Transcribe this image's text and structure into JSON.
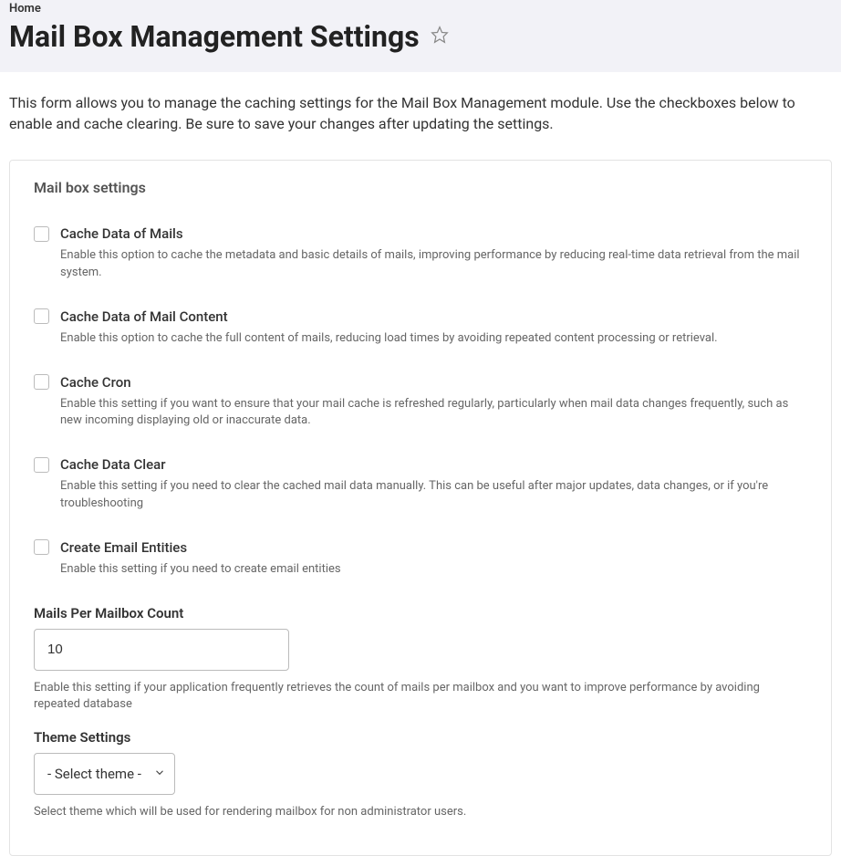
{
  "breadcrumb": {
    "home": "Home"
  },
  "page": {
    "title": "Mail Box Management Settings"
  },
  "intro": "This form allows you to manage the caching settings for the Mail Box Management module. Use the checkboxes below to enable and cache clearing. Be sure to save your changes after updating the settings.",
  "panel": {
    "title": "Mail box settings"
  },
  "checks": [
    {
      "label": "Cache Data of Mails",
      "desc": "Enable this option to cache the metadata and basic details of mails, improving performance by reducing real-time data retrieval from the mail system."
    },
    {
      "label": "Cache Data of Mail Content",
      "desc": "Enable this option to cache the full content of mails, reducing load times by avoiding repeated content processing or retrieval."
    },
    {
      "label": "Cache Cron",
      "desc": "Enable this setting if you want to ensure that your mail cache is refreshed regularly, particularly when mail data changes frequently, such as new incoming displaying old or inaccurate data."
    },
    {
      "label": "Cache Data Clear",
      "desc": "Enable this setting if you need to clear the cached mail data manually. This can be useful after major updates, data changes, or if you're troubleshooting"
    },
    {
      "label": "Create Email Entities",
      "desc": "Enable this setting if you need to create email entities"
    }
  ],
  "mailsPerMailbox": {
    "label": "Mails Per Mailbox Count",
    "value": "10",
    "desc": "Enable this setting if your application frequently retrieves the count of mails per mailbox and you want to improve performance by avoiding repeated database"
  },
  "theme": {
    "label": "Theme Settings",
    "placeholder": "- Select theme -",
    "desc": "Select theme which will be used for rendering mailbox for non administrator users."
  }
}
